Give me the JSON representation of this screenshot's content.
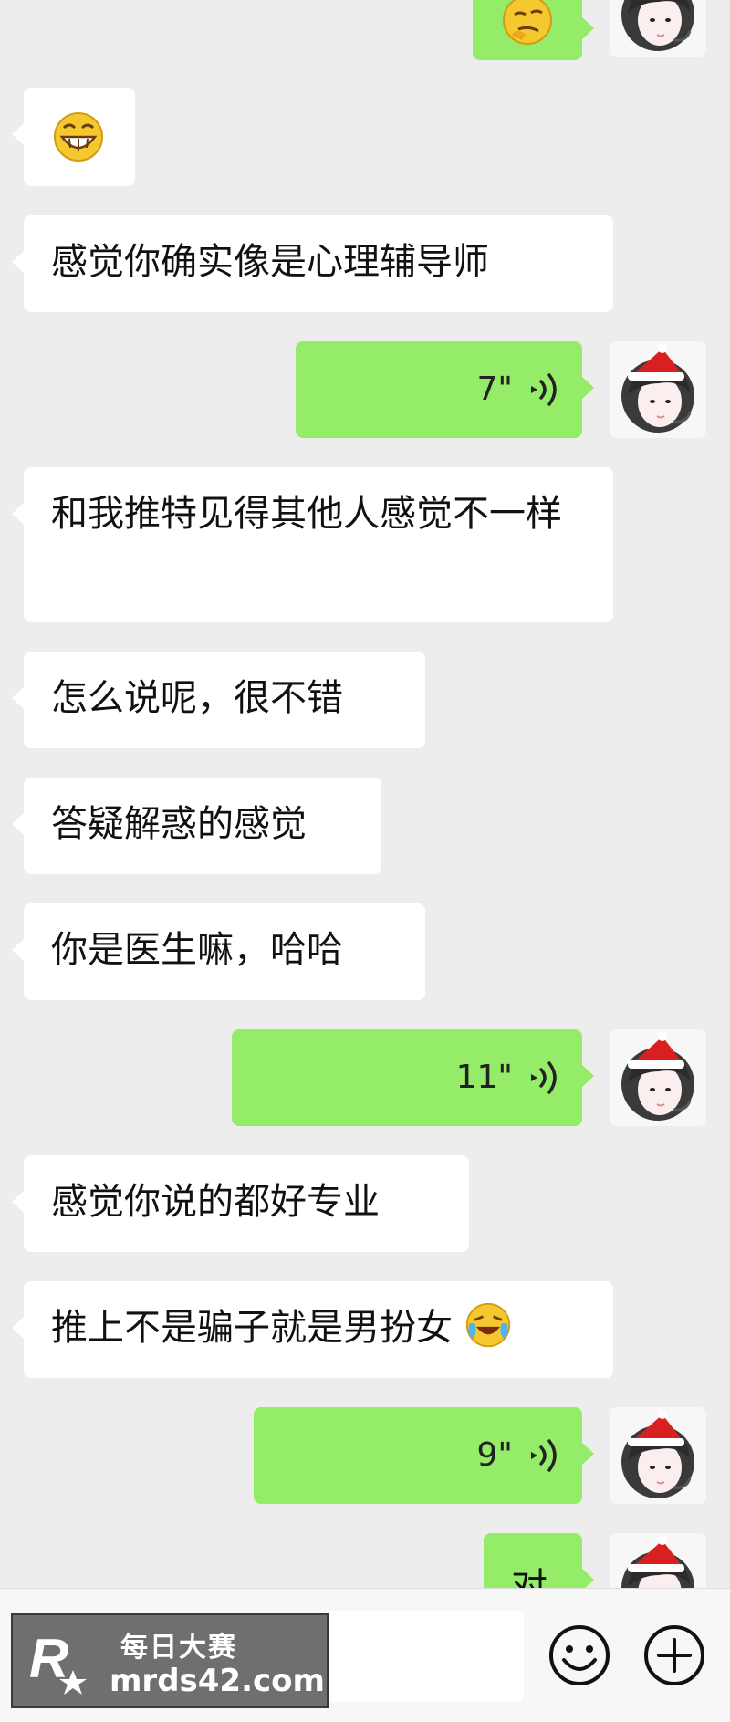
{
  "messages": [
    {
      "side": "out",
      "kind": "emoji",
      "emoji": "thinking-face-icon"
    },
    {
      "side": "in",
      "kind": "emoji",
      "emoji": "grinning-face-icon"
    },
    {
      "side": "in",
      "kind": "text",
      "text": "感觉你确实像是心理辅导师"
    },
    {
      "side": "out",
      "kind": "voice",
      "duration": "7\""
    },
    {
      "side": "in",
      "kind": "text",
      "text": "和我推特见得其他人感觉不一样"
    },
    {
      "side": "in",
      "kind": "text",
      "text": "怎么说呢，很不错"
    },
    {
      "side": "in",
      "kind": "text",
      "text": "答疑解惑的感觉"
    },
    {
      "side": "in",
      "kind": "text",
      "text": "你是医生嘛，哈哈"
    },
    {
      "side": "out",
      "kind": "voice",
      "duration": "11\""
    },
    {
      "side": "in",
      "kind": "text",
      "text": "感觉你说的都好专业"
    },
    {
      "side": "in",
      "kind": "text",
      "text": "推上不是骗子就是男扮女",
      "trailing_emoji": "crying-laughing-face-icon"
    },
    {
      "side": "out",
      "kind": "voice",
      "duration": "9\""
    },
    {
      "side": "out",
      "kind": "text",
      "text": "对"
    }
  ],
  "input_bar": {
    "emoji_button": "smiley-icon",
    "more_button": "plus-circle-icon"
  },
  "watermark": {
    "cn": "每日大赛",
    "en": "mrds42.com"
  },
  "colors": {
    "background": "#ededed",
    "incoming_bubble": "#ffffff",
    "outgoing_bubble": "#95ec69"
  }
}
